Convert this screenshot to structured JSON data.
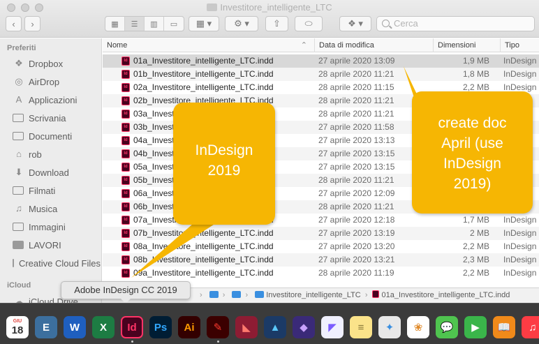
{
  "window": {
    "title": "Investitore_intelligente_LTC",
    "search_placeholder": "Cerca",
    "back_glyph": "‹",
    "forward_glyph": "›"
  },
  "sidebar": {
    "favorites_heading": "Preferiti",
    "items": [
      {
        "label": "Dropbox",
        "icon": "dropbox-icon"
      },
      {
        "label": "AirDrop",
        "icon": "airdrop-icon"
      },
      {
        "label": "Applicazioni",
        "icon": "applications-icon"
      },
      {
        "label": "Scrivania",
        "icon": "desktop-icon"
      },
      {
        "label": "Documenti",
        "icon": "documents-icon"
      },
      {
        "label": "rob",
        "icon": "home-icon"
      },
      {
        "label": "Download",
        "icon": "download-icon"
      },
      {
        "label": "Filmati",
        "icon": "movies-icon"
      },
      {
        "label": "Musica",
        "icon": "music-icon"
      },
      {
        "label": "Immagini",
        "icon": "pictures-icon"
      },
      {
        "label": "LAVORI",
        "icon": "folder-icon"
      },
      {
        "label": "Creative Cloud Files",
        "icon": "folder-icon"
      }
    ],
    "icloud_heading": "iCloud",
    "icloud_items": [
      {
        "label": "iCloud Drive",
        "icon": "icloud-icon"
      }
    ]
  },
  "columns": {
    "name": "Nome",
    "date": "Data di modifica",
    "size": "Dimensioni",
    "type": "Tipo"
  },
  "files": [
    {
      "name": "01a_Investitore_intelligente_LTC.indd",
      "date": "27 aprile 2020 13:09",
      "size": "1,9 MB",
      "type": "InDesign"
    },
    {
      "name": "01b_Investitore_intelligente_LTC.indd",
      "date": "28 aprile 2020 11:21",
      "size": "1,8 MB",
      "type": "InDesign"
    },
    {
      "name": "02a_Investitore_intelligente_LTC.indd",
      "date": "28 aprile 2020 11:15",
      "size": "2,2 MB",
      "type": "InDesign"
    },
    {
      "name": "02b_Investitore_intelligente_LTC.indd",
      "date": "28 aprile 2020 11:21",
      "size": "",
      "type": ""
    },
    {
      "name": "03a_Investitore_intelligente_LTC.indd",
      "date": "28 aprile 2020 11:21",
      "size": "",
      "type": ""
    },
    {
      "name": "03b_Investitore_intelligente_LTC.indd",
      "date": "27 aprile 2020 11:58",
      "size": "",
      "type": ""
    },
    {
      "name": "04a_Investitore_intelligente_LTC.indd",
      "date": "27 aprile 2020 13:13",
      "size": "",
      "type": ""
    },
    {
      "name": "04b_Investitore_intelligente_LTC.indd",
      "date": "27 aprile 2020 13:15",
      "size": "",
      "type": ""
    },
    {
      "name": "05a_Investitore_intelligente_LTC.indd",
      "date": "27 aprile 2020 13:15",
      "size": "",
      "type": ""
    },
    {
      "name": "05b_Investitore_intelligente_LTC.indd",
      "date": "28 aprile 2020 11:21",
      "size": "",
      "type": ""
    },
    {
      "name": "06a_Investitore_intelligente_LTC.indd",
      "date": "27 aprile 2020 12:09",
      "size": "",
      "type": ""
    },
    {
      "name": "06b_Investitore_intelligente_LTC.indd",
      "date": "28 aprile 2020 11:21",
      "size": "",
      "type": ""
    },
    {
      "name": "07a_Investitore_intelligente_LTC.indd",
      "date": "27 aprile 2020 12:18",
      "size": "1,7 MB",
      "type": "InDesign"
    },
    {
      "name": "07b_Investitore_intelligente_LTC.indd",
      "date": "27 aprile 2020 13:19",
      "size": "2 MB",
      "type": "InDesign"
    },
    {
      "name": "08a_Investitore_intelligente_LTC.indd",
      "date": "27 aprile 2020 13:20",
      "size": "2,2 MB",
      "type": "InDesign"
    },
    {
      "name": "08b_Investitore_intelligente_LTC.indd",
      "date": "27 aprile 2020 13:21",
      "size": "2,3 MB",
      "type": "InDesign"
    },
    {
      "name": "09a_Investitore_intelligente_LTC.indd",
      "date": "28 aprile 2020 11:19",
      "size": "2,2 MB",
      "type": "InDesign"
    }
  ],
  "pathbar": {
    "folder": "Investitore_intelligente_LTC",
    "file": "01a_Investitore_intelligente_LTC.indd"
  },
  "tooltip": "Adobe InDesign CC 2019",
  "callouts": {
    "left": "InDesign\n2019",
    "right": "create doc\nApril (use\nInDesign\n2019)"
  },
  "colors": {
    "callout": "#f6b603",
    "indesign": "#ff3366"
  },
  "dock": [
    {
      "name": "calendar-dock-icon",
      "label": "18",
      "sub": "GIU",
      "bg": "#ffffff",
      "fg": "#e0443e"
    },
    {
      "name": "exchange-dock-icon",
      "label": "E",
      "bg": "#3c6f9e",
      "fg": "#ffffff"
    },
    {
      "name": "word-dock-icon",
      "label": "W",
      "bg": "#1f5fbf",
      "fg": "#ffffff"
    },
    {
      "name": "excel-dock-icon",
      "label": "X",
      "bg": "#1d7c43",
      "fg": "#ffffff"
    },
    {
      "name": "indesign-dock-icon",
      "label": "Id",
      "bg": "#49021f",
      "fg": "#ff3366"
    },
    {
      "name": "photoshop-dock-icon",
      "label": "Ps",
      "bg": "#001d34",
      "fg": "#31a8ff"
    },
    {
      "name": "illustrator-dock-icon",
      "label": "Ai",
      "bg": "#330000",
      "fg": "#ff9a00"
    },
    {
      "name": "acrobat-dock-icon",
      "label": "✎",
      "bg": "#3b0000",
      "fg": "#ff3b30"
    },
    {
      "name": "affinity-publisher-dock-icon",
      "label": "◣",
      "bg": "#8d1c33",
      "fg": "#ff7a6e"
    },
    {
      "name": "affinity-designer-dock-icon",
      "label": "▲",
      "bg": "#1b3a66",
      "fg": "#5ac8fa"
    },
    {
      "name": "affinity-photo-dock-icon",
      "label": "◆",
      "bg": "#3a2a78",
      "fg": "#c8a2ff"
    },
    {
      "name": "vectornator-dock-icon",
      "label": "◤",
      "bg": "#f0f0ff",
      "fg": "#7b5cff"
    },
    {
      "name": "notes-dock-icon",
      "label": "≡",
      "bg": "#fbe38a",
      "fg": "#8a7a3a"
    },
    {
      "name": "preview-dock-icon",
      "label": "✦",
      "bg": "#e8e8e8",
      "fg": "#3a8fe0"
    },
    {
      "name": "photos-dock-icon",
      "label": "❀",
      "bg": "#ffffff",
      "fg": "#e08a2a"
    },
    {
      "name": "messages-dock-icon",
      "label": "💬",
      "bg": "#4fc44f",
      "fg": "#ffffff"
    },
    {
      "name": "facetime-dock-icon",
      "label": "▶",
      "bg": "#3ab54a",
      "fg": "#ffffff"
    },
    {
      "name": "books-dock-icon",
      "label": "📖",
      "bg": "#f08a1a",
      "fg": "#ffffff"
    },
    {
      "name": "music-dock-icon",
      "label": "♫",
      "bg": "#fc3c44",
      "fg": "#ffffff"
    },
    {
      "name": "podcasts-dock-icon",
      "label": "◉",
      "bg": "#a53dd6",
      "fg": "#ffffff"
    }
  ]
}
